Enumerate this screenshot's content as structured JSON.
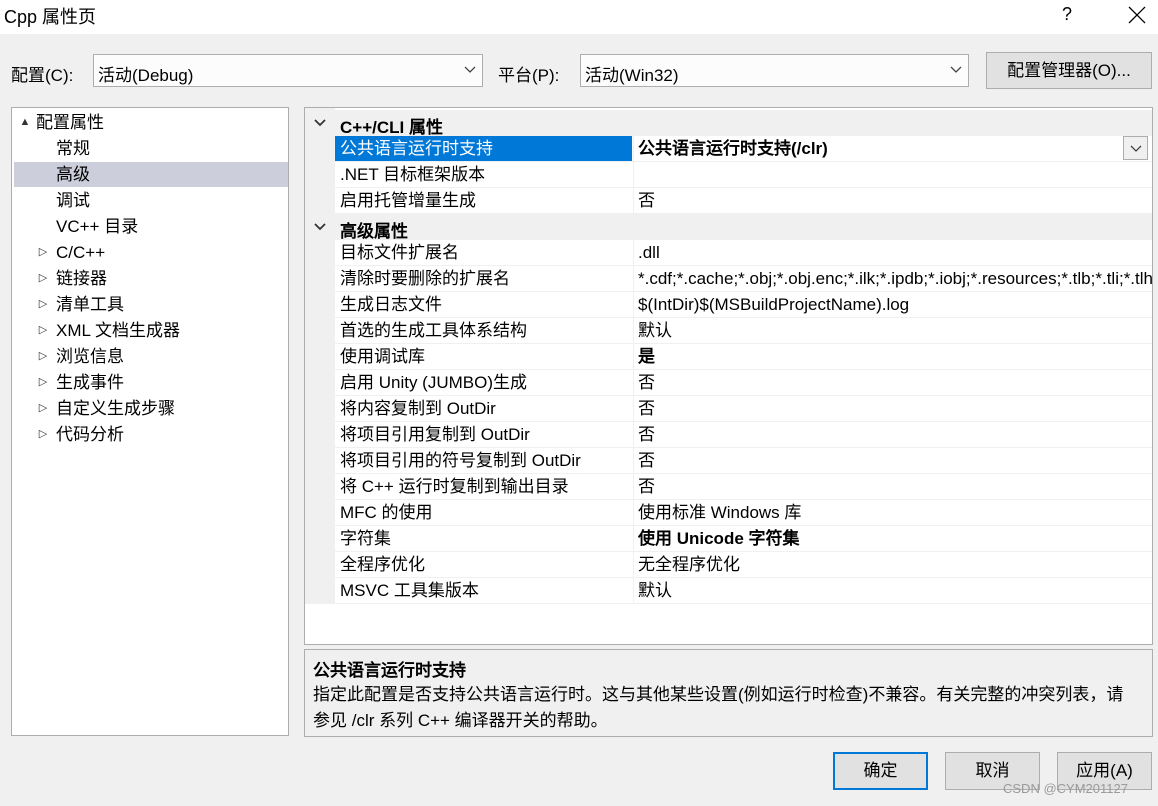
{
  "window": {
    "title": "Cpp 属性页",
    "help_label": "?",
    "close_icon": "close-icon"
  },
  "config_bar": {
    "config_label": "配置(C):",
    "config_value": "活动(Debug)",
    "platform_label": "平台(P):",
    "platform_value": "活动(Win32)",
    "manager_button": "配置管理器(O)..."
  },
  "tree": {
    "root": {
      "label": "配置属性",
      "expander": "▲"
    },
    "items": [
      {
        "label": "常规",
        "expander": ""
      },
      {
        "label": "高级",
        "expander": "",
        "selected": true
      },
      {
        "label": "调试",
        "expander": ""
      },
      {
        "label": "VC++ 目录",
        "expander": ""
      },
      {
        "label": "C/C++",
        "expander": "▷"
      },
      {
        "label": "链接器",
        "expander": "▷"
      },
      {
        "label": "清单工具",
        "expander": "▷"
      },
      {
        "label": "XML 文档生成器",
        "expander": "▷"
      },
      {
        "label": "浏览信息",
        "expander": "▷"
      },
      {
        "label": "生成事件",
        "expander": "▷"
      },
      {
        "label": "自定义生成步骤",
        "expander": "▷"
      },
      {
        "label": "代码分析",
        "expander": "▷"
      }
    ]
  },
  "grid": {
    "categories": [
      {
        "name": "C++/CLI 属性",
        "rows": [
          {
            "name": "公共语言运行时支持",
            "value": "公共语言运行时支持(/clr)",
            "bold": true,
            "selected": true
          },
          {
            "name": ".NET 目标框架版本",
            "value": ""
          },
          {
            "name": "启用托管增量生成",
            "value": "否"
          }
        ]
      },
      {
        "name": "高级属性",
        "rows": [
          {
            "name": "目标文件扩展名",
            "value": ".dll"
          },
          {
            "name": "清除时要删除的扩展名",
            "value": "*.cdf;*.cache;*.obj;*.obj.enc;*.ilk;*.ipdb;*.iobj;*.resources;*.tlb;*.tli;*.tlh;*.tmp;*.rsp"
          },
          {
            "name": "生成日志文件",
            "value": "$(IntDir)$(MSBuildProjectName).log"
          },
          {
            "name": "首选的生成工具体系结构",
            "value": "默认"
          },
          {
            "name": "使用调试库",
            "value": "是",
            "bold": true
          },
          {
            "name": "启用 Unity (JUMBO)生成",
            "value": "否"
          },
          {
            "name": "将内容复制到 OutDir",
            "value": "否"
          },
          {
            "name": "将项目引用复制到 OutDir",
            "value": "否"
          },
          {
            "name": "将项目引用的符号复制到 OutDir",
            "value": "否"
          },
          {
            "name": "将 C++ 运行时复制到输出目录",
            "value": "否"
          },
          {
            "name": "MFC 的使用",
            "value": "使用标准 Windows 库"
          },
          {
            "name": "字符集",
            "value": "使用 Unicode 字符集",
            "bold": true
          },
          {
            "name": "全程序优化",
            "value": "无全程序优化"
          },
          {
            "name": "MSVC 工具集版本",
            "value": "默认"
          }
        ]
      }
    ]
  },
  "description": {
    "title": "公共语言运行时支持",
    "text": "指定此配置是否支持公共语言运行时。这与其他某些设置(例如运行时检查)不兼容。有关完整的冲突列表，请参见 /clr 系列 C++ 编译器开关的帮助。"
  },
  "buttons": {
    "ok": "确定",
    "cancel": "取消",
    "apply": "应用(A)"
  },
  "watermark": "CSDN @CYM201127",
  "colors": {
    "selection": "#0078d7",
    "tree_selection": "#cccedb"
  }
}
